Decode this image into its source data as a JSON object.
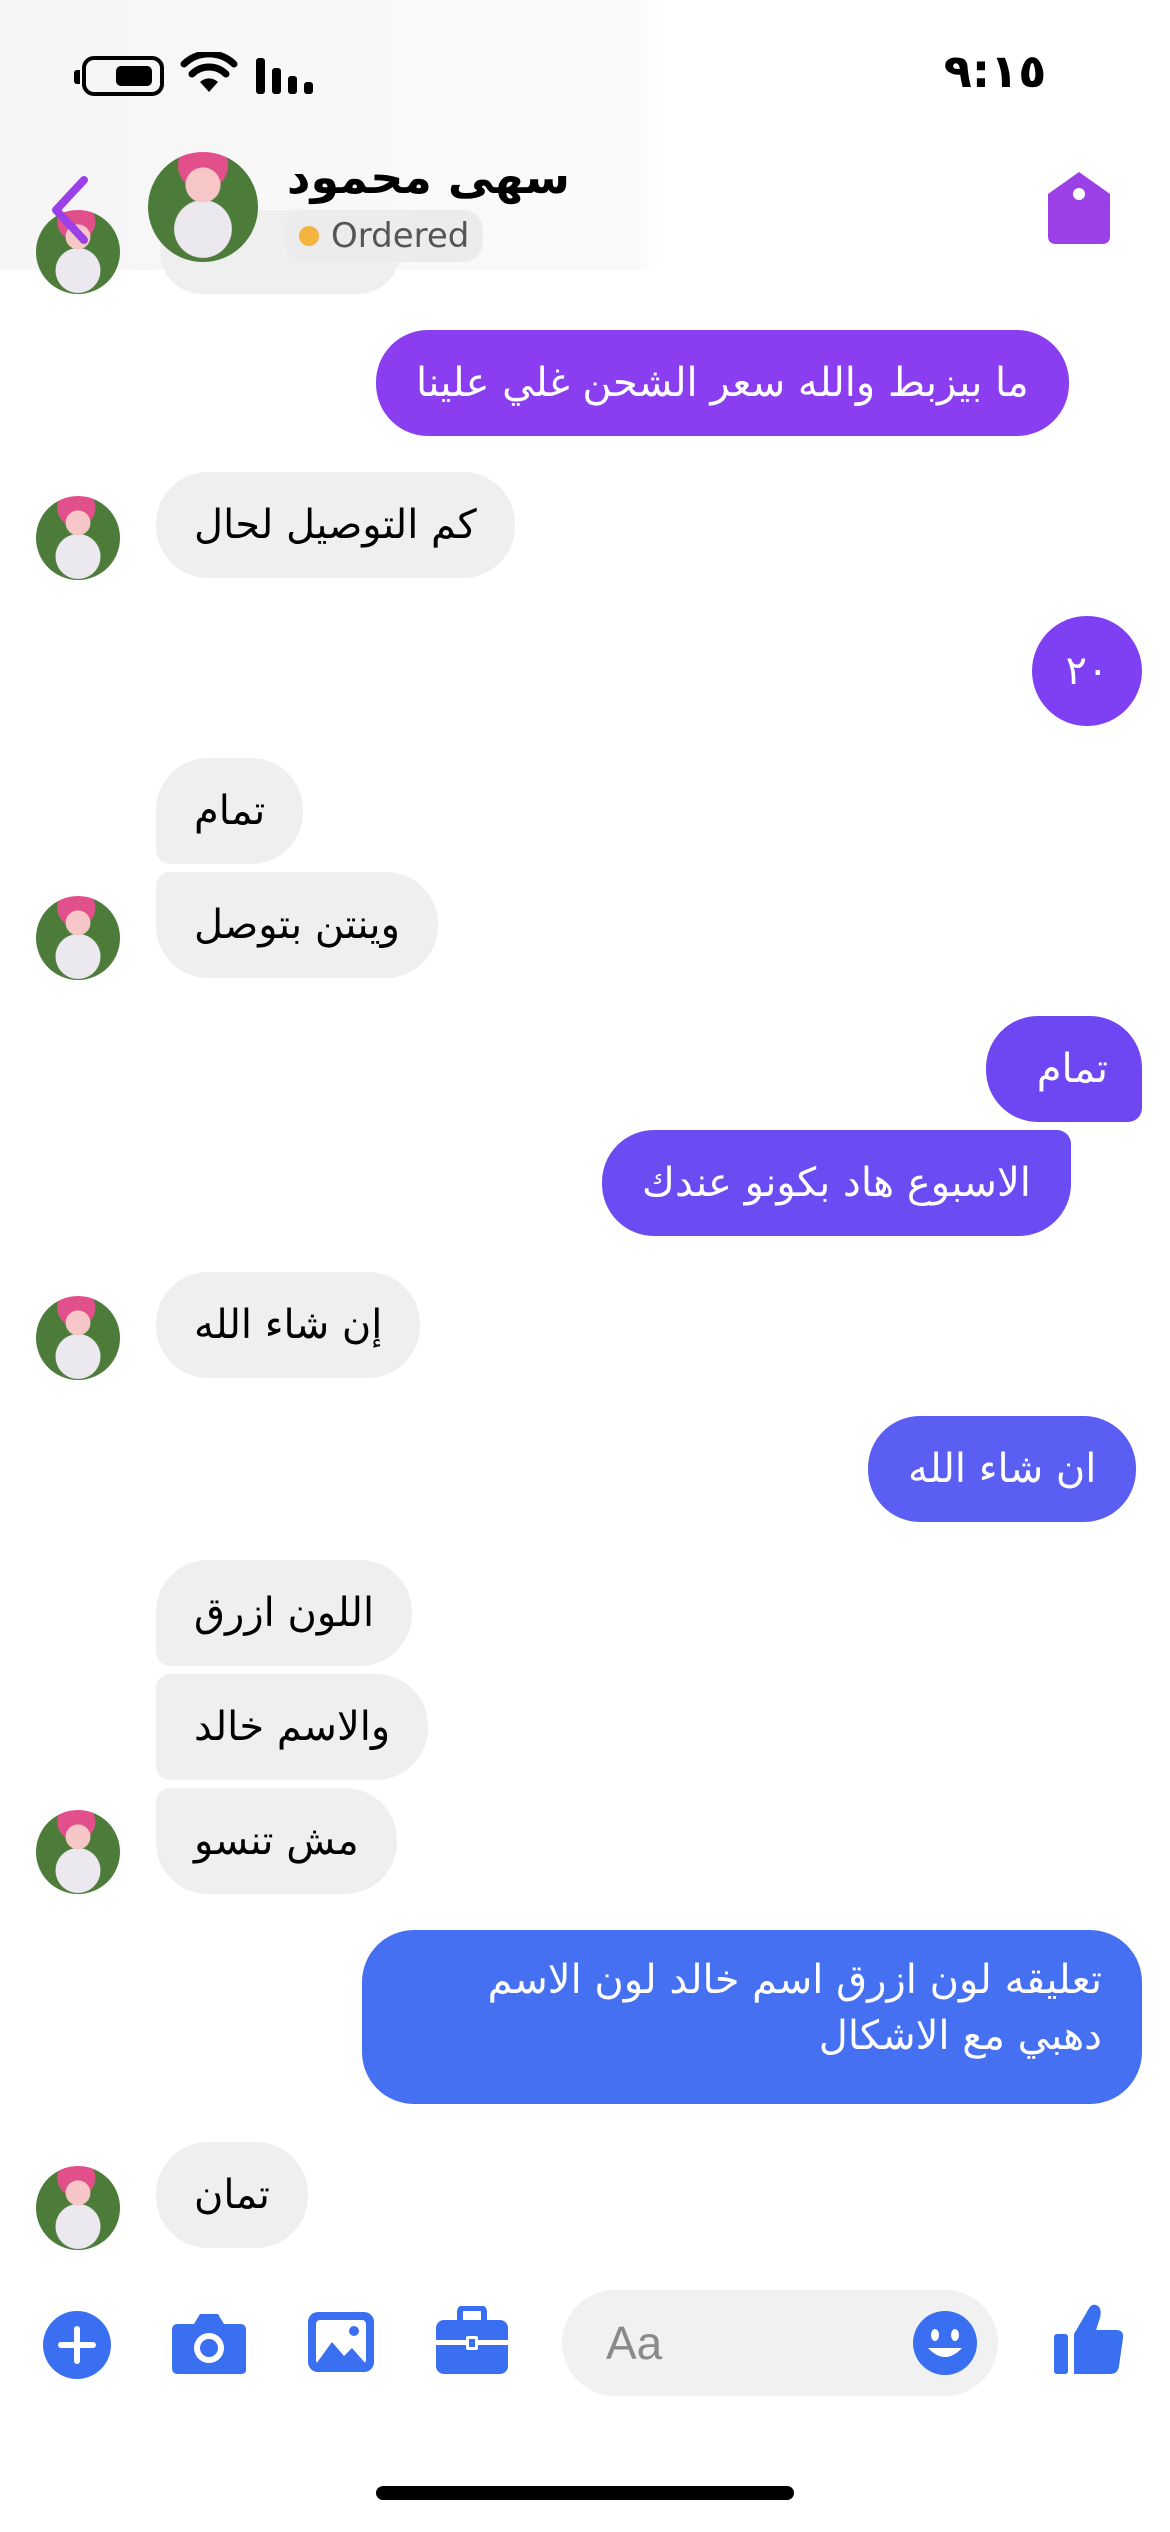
{
  "status_bar": {
    "time": "٩:١٥"
  },
  "header": {
    "contact_name": "سهى محمود",
    "status_label": "Ordered",
    "colors": {
      "accent": "#9b3fe6",
      "status_dot": "#f5b43f"
    },
    "icons": {
      "back": "chevron-left-icon",
      "tag": "tag-icon"
    }
  },
  "messages": [
    {
      "side": "outgoing",
      "text": "ما بيزبط والله سعر الشحن غلي علينا",
      "color": "#8b3df0"
    },
    {
      "side": "incoming",
      "text": "كم التوصيل لحال"
    },
    {
      "side": "outgoing",
      "text": "٢٠",
      "color": "#7e40f2"
    },
    {
      "side": "incoming",
      "text": "تمام"
    },
    {
      "side": "incoming",
      "text": "وينتن بتوصل"
    },
    {
      "side": "outgoing",
      "text": "تمام",
      "color": "#6f47f2"
    },
    {
      "side": "outgoing",
      "text": "الاسبوع هاد بكونو عندك",
      "color": "#6a4cf2"
    },
    {
      "side": "incoming",
      "text": "إن شاء الله"
    },
    {
      "side": "outgoing",
      "text": "ان شاء الله",
      "color": "#5a5ef2"
    },
    {
      "side": "incoming",
      "text": "اللون ازرق"
    },
    {
      "side": "incoming",
      "text": "والاسم خالد"
    },
    {
      "side": "incoming",
      "text": "مش تنسو"
    },
    {
      "side": "outgoing",
      "text": "تعليقه لون ازرق اسم خالد لون الاسم",
      "text2": "دهبي مع الاشكال",
      "color": "#4670f2"
    },
    {
      "side": "incoming",
      "text": "تمان"
    }
  ],
  "composer": {
    "placeholder": "Aa",
    "icons": [
      "plus-icon",
      "camera-icon",
      "image-icon",
      "briefcase-icon",
      "emoji-icon",
      "thumbs-up-icon"
    ],
    "icon_color": "#3a6ff2"
  }
}
